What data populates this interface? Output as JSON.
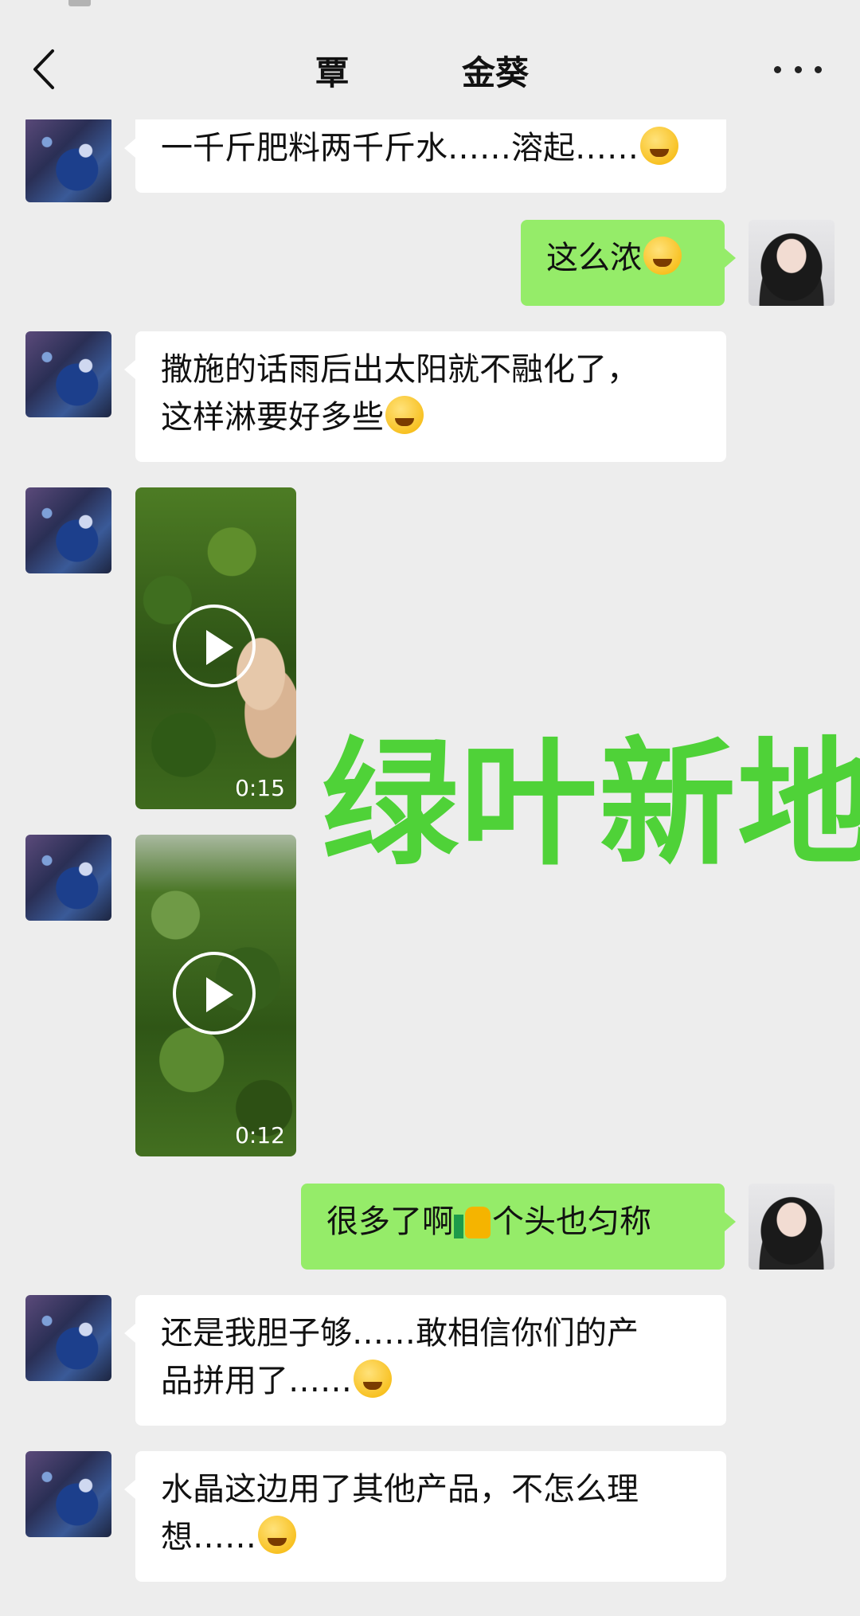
{
  "header": {
    "back_icon": "chevron-left-icon",
    "title_left": "覃",
    "title_right": "金葵",
    "more_icon": "more-horizontal-icon"
  },
  "messages": [
    {
      "side": "left",
      "type": "text",
      "text": "一千斤肥料两千斤水……溶起……",
      "emoji": "face-with-tears-icon"
    },
    {
      "side": "right",
      "type": "text",
      "text": "这么浓",
      "emoji": "laughing-tears-icon"
    },
    {
      "side": "left",
      "type": "text",
      "line1": "撒施的话雨后出太阳就不融化了，",
      "line2": "这样淋要好多些",
      "emoji": "thinking-face-icon"
    },
    {
      "side": "left",
      "type": "video",
      "duration": "0:15"
    },
    {
      "side": "left",
      "type": "video",
      "duration": "0:12"
    },
    {
      "side": "right",
      "type": "text",
      "before": "很多了啊",
      "after": "个头也匀称",
      "emoji": "thumbs-up-icon"
    },
    {
      "side": "left",
      "type": "text",
      "line1": "还是我胆子够……敢相信你们的产",
      "line2": "品拼用了……",
      "emoji": "face-with-tears-icon"
    },
    {
      "side": "left",
      "type": "text",
      "line1": "水晶这边用了其他产品，不怎么理",
      "line2": "想……",
      "emoji": "face-with-tears-icon"
    }
  ],
  "watermark": "绿叶新地",
  "colors": {
    "background": "#ededed",
    "bubble_left": "#ffffff",
    "bubble_right": "#95ec69",
    "watermark": "#4fd238"
  }
}
